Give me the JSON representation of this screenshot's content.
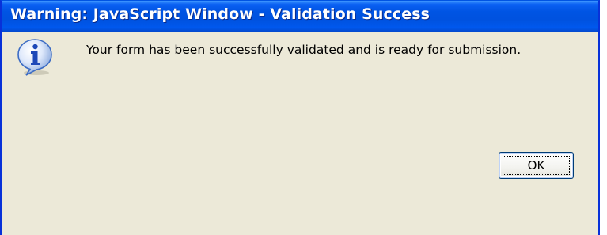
{
  "window": {
    "title": "Warning: JavaScript Window - Validation Success"
  },
  "dialog": {
    "icon": "info-icon",
    "message": "Your form has been successfully validated and is ready for submission.",
    "ok_label": "OK"
  },
  "colors": {
    "titlebar": "#0054e3",
    "frame": "#0831d9",
    "dialog_background": "#ece9d8",
    "button_border": "#003c74"
  }
}
